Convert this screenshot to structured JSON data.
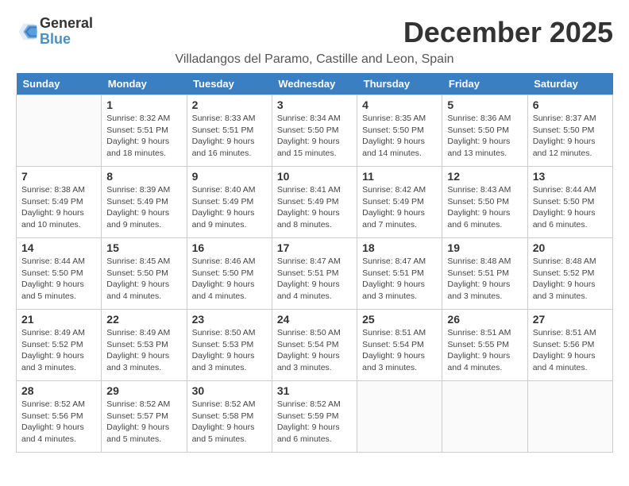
{
  "header": {
    "logo_general": "General",
    "logo_blue": "Blue",
    "title": "December 2025",
    "subtitle": "Villadangos del Paramo, Castille and Leon, Spain"
  },
  "weekdays": [
    "Sunday",
    "Monday",
    "Tuesday",
    "Wednesday",
    "Thursday",
    "Friday",
    "Saturday"
  ],
  "weeks": [
    [
      {
        "day": "",
        "sunrise": "",
        "sunset": "",
        "daylight": ""
      },
      {
        "day": "1",
        "sunrise": "Sunrise: 8:32 AM",
        "sunset": "Sunset: 5:51 PM",
        "daylight": "Daylight: 9 hours and 18 minutes."
      },
      {
        "day": "2",
        "sunrise": "Sunrise: 8:33 AM",
        "sunset": "Sunset: 5:51 PM",
        "daylight": "Daylight: 9 hours and 16 minutes."
      },
      {
        "day": "3",
        "sunrise": "Sunrise: 8:34 AM",
        "sunset": "Sunset: 5:50 PM",
        "daylight": "Daylight: 9 hours and 15 minutes."
      },
      {
        "day": "4",
        "sunrise": "Sunrise: 8:35 AM",
        "sunset": "Sunset: 5:50 PM",
        "daylight": "Daylight: 9 hours and 14 minutes."
      },
      {
        "day": "5",
        "sunrise": "Sunrise: 8:36 AM",
        "sunset": "Sunset: 5:50 PM",
        "daylight": "Daylight: 9 hours and 13 minutes."
      },
      {
        "day": "6",
        "sunrise": "Sunrise: 8:37 AM",
        "sunset": "Sunset: 5:50 PM",
        "daylight": "Daylight: 9 hours and 12 minutes."
      }
    ],
    [
      {
        "day": "7",
        "sunrise": "Sunrise: 8:38 AM",
        "sunset": "Sunset: 5:49 PM",
        "daylight": "Daylight: 9 hours and 10 minutes."
      },
      {
        "day": "8",
        "sunrise": "Sunrise: 8:39 AM",
        "sunset": "Sunset: 5:49 PM",
        "daylight": "Daylight: 9 hours and 9 minutes."
      },
      {
        "day": "9",
        "sunrise": "Sunrise: 8:40 AM",
        "sunset": "Sunset: 5:49 PM",
        "daylight": "Daylight: 9 hours and 9 minutes."
      },
      {
        "day": "10",
        "sunrise": "Sunrise: 8:41 AM",
        "sunset": "Sunset: 5:49 PM",
        "daylight": "Daylight: 9 hours and 8 minutes."
      },
      {
        "day": "11",
        "sunrise": "Sunrise: 8:42 AM",
        "sunset": "Sunset: 5:49 PM",
        "daylight": "Daylight: 9 hours and 7 minutes."
      },
      {
        "day": "12",
        "sunrise": "Sunrise: 8:43 AM",
        "sunset": "Sunset: 5:50 PM",
        "daylight": "Daylight: 9 hours and 6 minutes."
      },
      {
        "day": "13",
        "sunrise": "Sunrise: 8:44 AM",
        "sunset": "Sunset: 5:50 PM",
        "daylight": "Daylight: 9 hours and 6 minutes."
      }
    ],
    [
      {
        "day": "14",
        "sunrise": "Sunrise: 8:44 AM",
        "sunset": "Sunset: 5:50 PM",
        "daylight": "Daylight: 9 hours and 5 minutes."
      },
      {
        "day": "15",
        "sunrise": "Sunrise: 8:45 AM",
        "sunset": "Sunset: 5:50 PM",
        "daylight": "Daylight: 9 hours and 4 minutes."
      },
      {
        "day": "16",
        "sunrise": "Sunrise: 8:46 AM",
        "sunset": "Sunset: 5:50 PM",
        "daylight": "Daylight: 9 hours and 4 minutes."
      },
      {
        "day": "17",
        "sunrise": "Sunrise: 8:47 AM",
        "sunset": "Sunset: 5:51 PM",
        "daylight": "Daylight: 9 hours and 4 minutes."
      },
      {
        "day": "18",
        "sunrise": "Sunrise: 8:47 AM",
        "sunset": "Sunset: 5:51 PM",
        "daylight": "Daylight: 9 hours and 3 minutes."
      },
      {
        "day": "19",
        "sunrise": "Sunrise: 8:48 AM",
        "sunset": "Sunset: 5:51 PM",
        "daylight": "Daylight: 9 hours and 3 minutes."
      },
      {
        "day": "20",
        "sunrise": "Sunrise: 8:48 AM",
        "sunset": "Sunset: 5:52 PM",
        "daylight": "Daylight: 9 hours and 3 minutes."
      }
    ],
    [
      {
        "day": "21",
        "sunrise": "Sunrise: 8:49 AM",
        "sunset": "Sunset: 5:52 PM",
        "daylight": "Daylight: 9 hours and 3 minutes."
      },
      {
        "day": "22",
        "sunrise": "Sunrise: 8:49 AM",
        "sunset": "Sunset: 5:53 PM",
        "daylight": "Daylight: 9 hours and 3 minutes."
      },
      {
        "day": "23",
        "sunrise": "Sunrise: 8:50 AM",
        "sunset": "Sunset: 5:53 PM",
        "daylight": "Daylight: 9 hours and 3 minutes."
      },
      {
        "day": "24",
        "sunrise": "Sunrise: 8:50 AM",
        "sunset": "Sunset: 5:54 PM",
        "daylight": "Daylight: 9 hours and 3 minutes."
      },
      {
        "day": "25",
        "sunrise": "Sunrise: 8:51 AM",
        "sunset": "Sunset: 5:54 PM",
        "daylight": "Daylight: 9 hours and 3 minutes."
      },
      {
        "day": "26",
        "sunrise": "Sunrise: 8:51 AM",
        "sunset": "Sunset: 5:55 PM",
        "daylight": "Daylight: 9 hours and 4 minutes."
      },
      {
        "day": "27",
        "sunrise": "Sunrise: 8:51 AM",
        "sunset": "Sunset: 5:56 PM",
        "daylight": "Daylight: 9 hours and 4 minutes."
      }
    ],
    [
      {
        "day": "28",
        "sunrise": "Sunrise: 8:52 AM",
        "sunset": "Sunset: 5:56 PM",
        "daylight": "Daylight: 9 hours and 4 minutes."
      },
      {
        "day": "29",
        "sunrise": "Sunrise: 8:52 AM",
        "sunset": "Sunset: 5:57 PM",
        "daylight": "Daylight: 9 hours and 5 minutes."
      },
      {
        "day": "30",
        "sunrise": "Sunrise: 8:52 AM",
        "sunset": "Sunset: 5:58 PM",
        "daylight": "Daylight: 9 hours and 5 minutes."
      },
      {
        "day": "31",
        "sunrise": "Sunrise: 8:52 AM",
        "sunset": "Sunset: 5:59 PM",
        "daylight": "Daylight: 9 hours and 6 minutes."
      },
      {
        "day": "",
        "sunrise": "",
        "sunset": "",
        "daylight": ""
      },
      {
        "day": "",
        "sunrise": "",
        "sunset": "",
        "daylight": ""
      },
      {
        "day": "",
        "sunrise": "",
        "sunset": "",
        "daylight": ""
      }
    ]
  ]
}
